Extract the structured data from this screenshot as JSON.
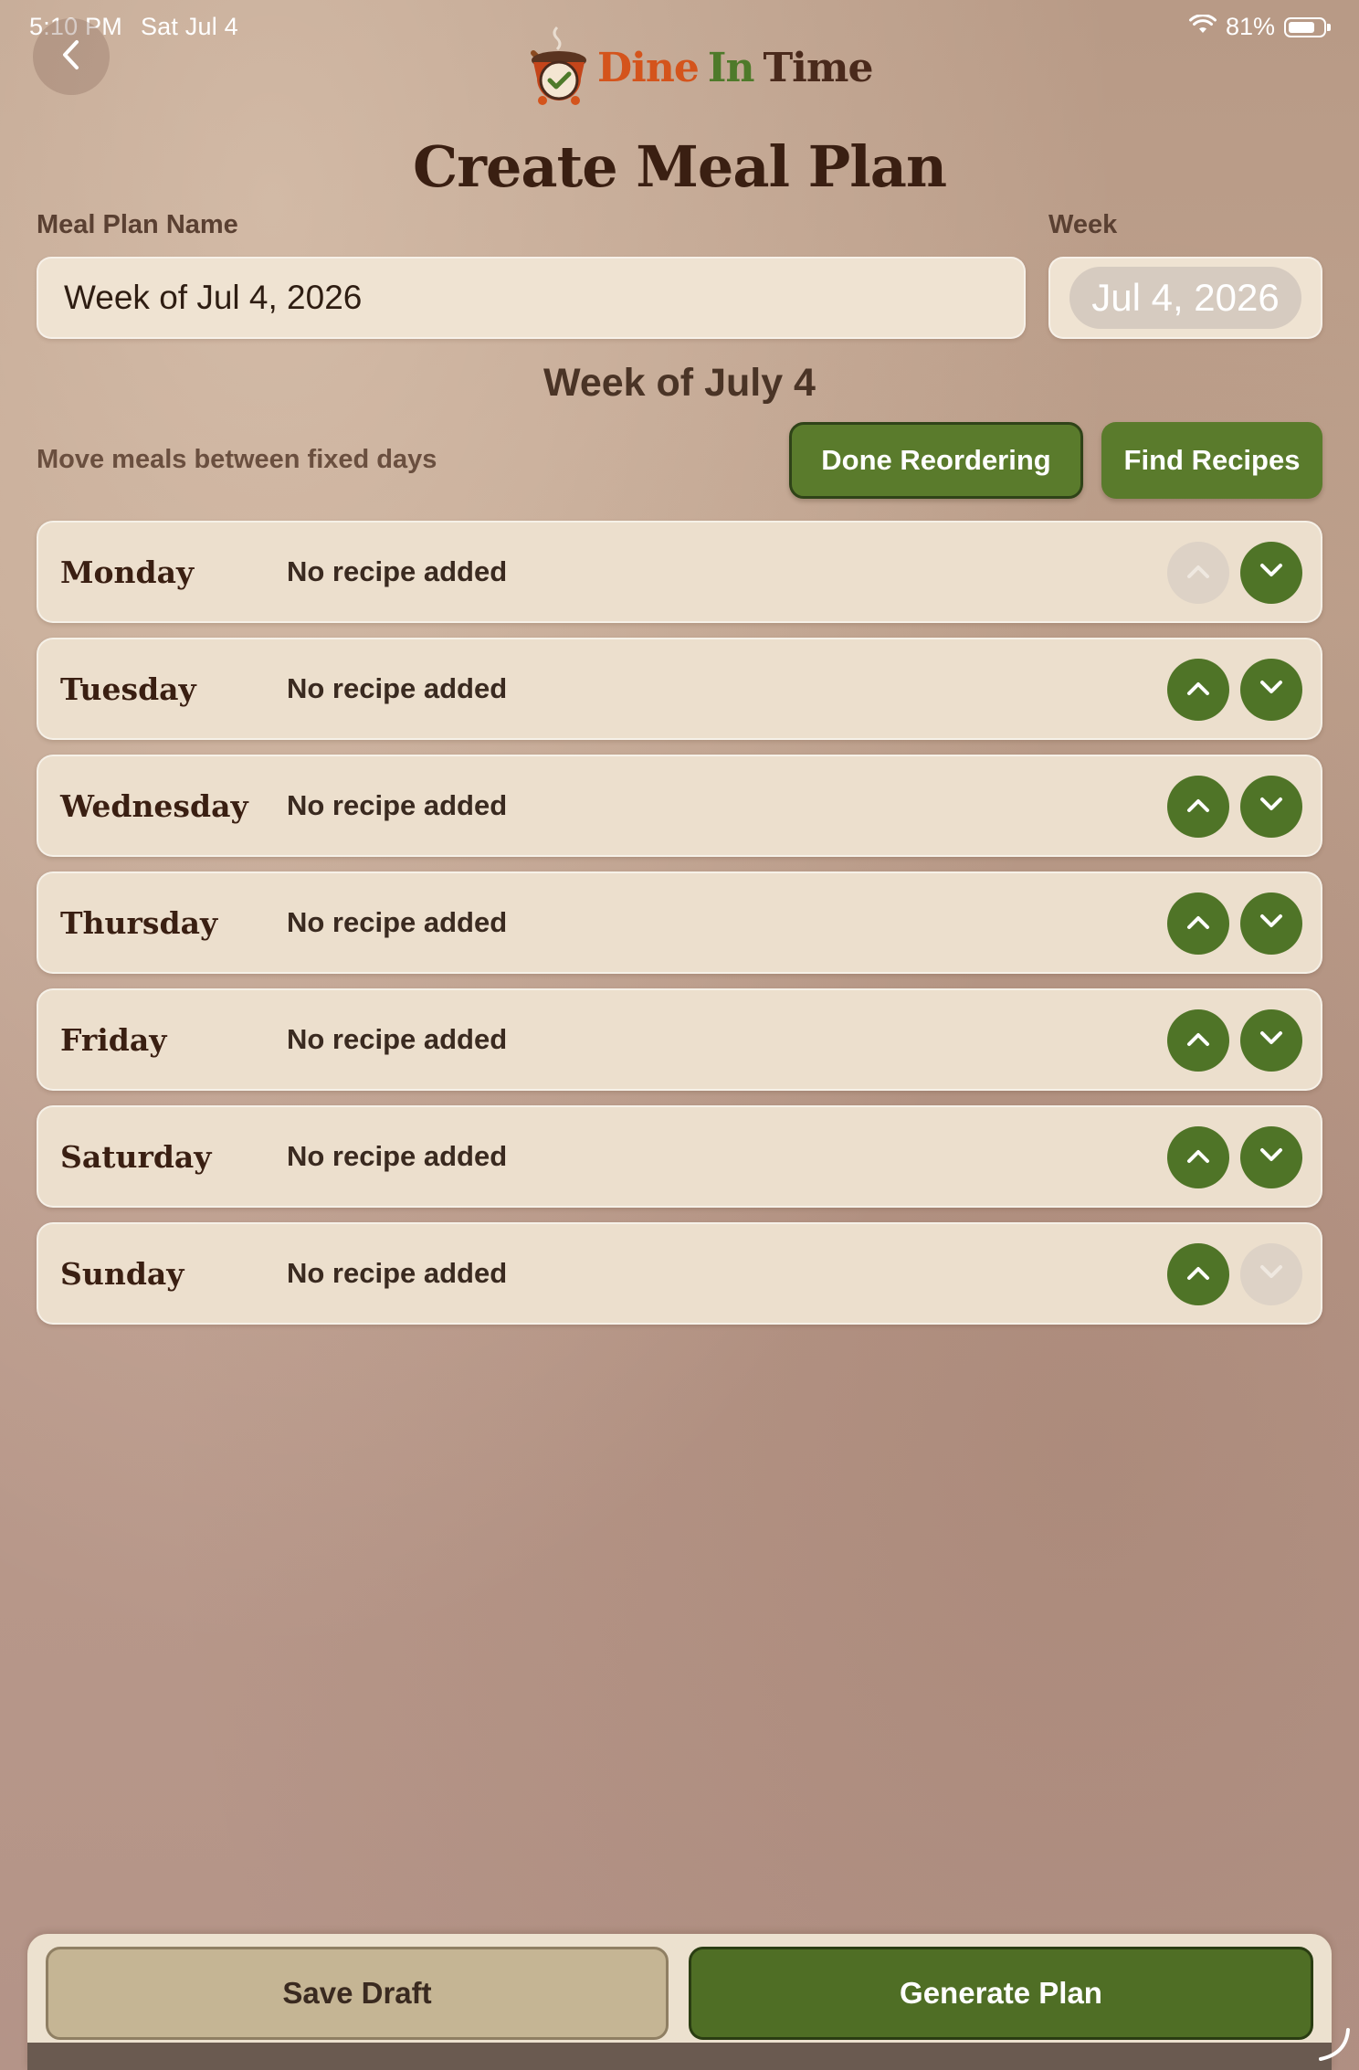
{
  "status": {
    "time": "5:10 PM",
    "date": "Sat Jul 4",
    "battery_text": "81%",
    "battery_level": 0.81
  },
  "logo": {
    "dine": "Dine",
    "in": "In",
    "time": "Time"
  },
  "page_title": "Create Meal Plan",
  "form": {
    "name_label": "Meal Plan Name",
    "name_value": "Week of Jul 4, 2026",
    "week_label": "Week",
    "week_value": "Jul 4, 2026"
  },
  "week_heading": "Week of July 4",
  "reorder": {
    "hint": "Move meals between fixed days",
    "done_label": "Done Reordering",
    "find_label": "Find Recipes"
  },
  "days": [
    {
      "name": "Monday",
      "recipe": "No recipe added",
      "up_enabled": false,
      "down_enabled": true
    },
    {
      "name": "Tuesday",
      "recipe": "No recipe added",
      "up_enabled": true,
      "down_enabled": true
    },
    {
      "name": "Wednesday",
      "recipe": "No recipe added",
      "up_enabled": true,
      "down_enabled": true
    },
    {
      "name": "Thursday",
      "recipe": "No recipe added",
      "up_enabled": true,
      "down_enabled": true
    },
    {
      "name": "Friday",
      "recipe": "No recipe added",
      "up_enabled": true,
      "down_enabled": true
    },
    {
      "name": "Saturday",
      "recipe": "No recipe added",
      "up_enabled": true,
      "down_enabled": true
    },
    {
      "name": "Sunday",
      "recipe": "No recipe added",
      "up_enabled": true,
      "down_enabled": false
    }
  ],
  "footer": {
    "save_label": "Save Draft",
    "generate_label": "Generate Plan"
  },
  "colors": {
    "accent_green": "#5a7b2c",
    "logo_orange": "#d4541c",
    "logo_green": "#4e7a2a",
    "text_brown": "#3a1f12"
  }
}
